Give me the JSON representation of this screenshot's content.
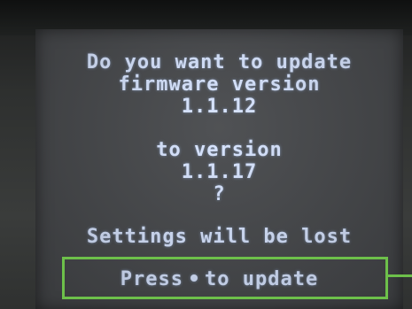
{
  "dialog": {
    "question_line1": "Do you want to update",
    "question_line2": "firmware version",
    "current_version": "1.1.12",
    "target_label": "to version",
    "target_version": "1.1.17",
    "question_mark": "?",
    "warning": "Settings will be lost",
    "prompt_before": "Press",
    "prompt_after": "to update",
    "prompt_button_icon": "round-button-icon"
  },
  "annotation": {
    "highlight_color": "#6dc04a"
  },
  "display": {
    "text_color": "#d7e4ff",
    "background_color": "#45474a"
  }
}
